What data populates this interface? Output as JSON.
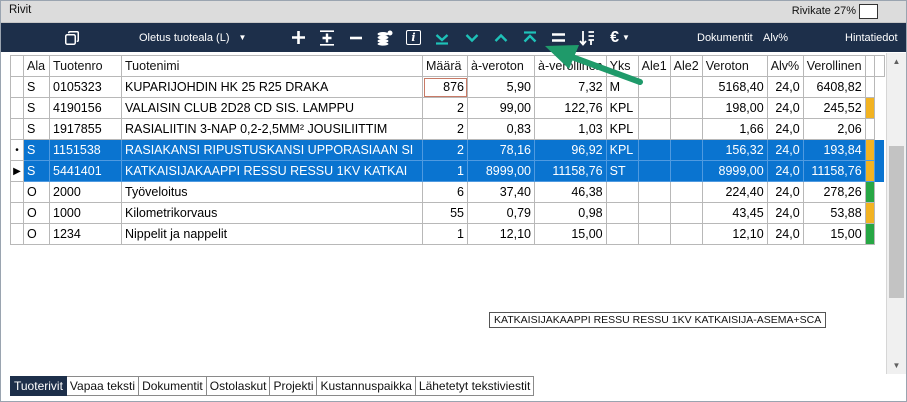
{
  "window": {
    "title": "Rivit",
    "rivikate_label": "Rivikate 27%"
  },
  "toolbar": {
    "product_area": "Oletus tuoteala (L)",
    "documents": "Dokumentit",
    "vat": "Alv%",
    "price_info": "Hintatiedot"
  },
  "table": {
    "headers": [
      "Ala",
      "Tuotenro",
      "Tuotenimi",
      "Määrä",
      "à-veroton",
      "à-verollinen",
      "Yks",
      "Ale1",
      "Ale2",
      "Veroton",
      "Alv%",
      "Verollinen"
    ],
    "rows": [
      [
        "S",
        "0105323",
        "KUPARIJOHDIN HK 25 R25 DRAKA",
        "876",
        "5,90",
        "7,32",
        "M",
        "",
        "",
        "5168,40",
        "24,0",
        "6408,82"
      ],
      [
        "S",
        "4190156",
        "VALAISIN CLUB 2D28 CD SIS. LAMPPU",
        "2",
        "99,00",
        "122,76",
        "KPL",
        "",
        "",
        "198,00",
        "24,0",
        "245,52"
      ],
      [
        "S",
        "1917855",
        "RASIALIITIN 3-NAP 0,2-2,5MM² JOUSILIITTIM",
        "2",
        "0,83",
        "1,03",
        "KPL",
        "",
        "",
        "1,66",
        "24,0",
        "2,06"
      ],
      [
        "S",
        "1151538",
        "RASIAKANSI RIPUSTUSKANSI UPPORASIAAN SI",
        "2",
        "78,16",
        "96,92",
        "KPL",
        "",
        "",
        "156,32",
        "24,0",
        "193,84"
      ],
      [
        "S",
        "5441401",
        "KATKAISIJAKAAPPI RESSU RESSU 1KV KATKAI",
        "1",
        "8999,00",
        "11158,76",
        "ST",
        "",
        "",
        "8999,00",
        "24,0",
        "11158,76"
      ],
      [
        "O",
        "2000",
        "Työveloitus",
        "6",
        "37,40",
        "46,38",
        "",
        "",
        "",
        "224,40",
        "24,0",
        "278,26"
      ],
      [
        "O",
        "1000",
        "Kilometrikorvaus",
        "55",
        "0,79",
        "0,98",
        "",
        "",
        "",
        "43,45",
        "24,0",
        "53,88"
      ],
      [
        "O",
        "1234",
        "Nippelit ja nappelit",
        "1",
        "12,10",
        "15,00",
        "",
        "",
        "",
        "12,10",
        "24,0",
        "15,00"
      ]
    ],
    "row_indicators": [
      "",
      "",
      "",
      "•",
      "▶",
      "",
      "",
      ""
    ],
    "row_flags": [
      "",
      "yellow",
      "",
      "yellow",
      "yellow",
      "green",
      "yellow",
      "green"
    ]
  },
  "tooltip": "KATKAISIJAKAAPPI RESSU RESSU 1KV KATKAISIJA-ASEMA+SCA",
  "tabs": [
    "Tuoterivit",
    "Vapaa teksti",
    "Dokumentit",
    "Ostolaskut",
    "Projekti",
    "Kustannuspaikka",
    "Lähetetyt tekstiviestit"
  ],
  "colors": {
    "toolbar_bg": "#1d2f4a",
    "selection": "#0a74d0",
    "teal_icons": "#1ec2b8",
    "annotation_arrow": "#1f9a6a",
    "flag_yellow": "#f2b322",
    "flag_green": "#27a744"
  },
  "icons": [
    "copy-icon",
    "plus-icon",
    "insert-row-icon",
    "minus-icon",
    "coins-icon",
    "info-icon",
    "move-bottom-icon",
    "move-down-icon",
    "move-up-icon",
    "move-top-icon",
    "equals-icon",
    "sort-icon",
    "euro-icon"
  ]
}
